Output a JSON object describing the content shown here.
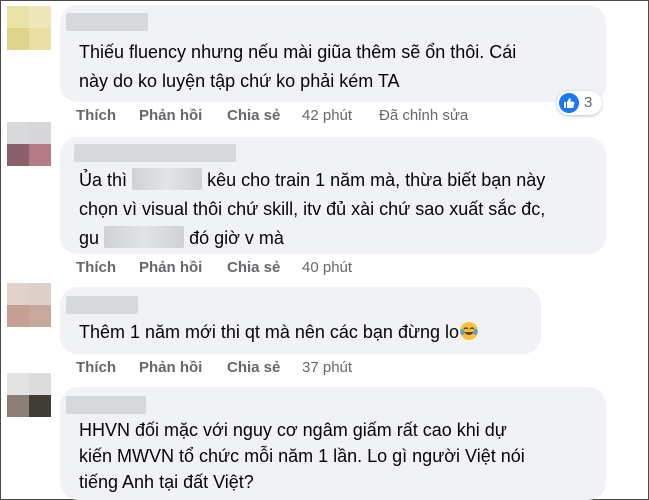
{
  "comments": [
    {
      "lines": [
        "Thiếu fluency nhưng nếu mài giũa thêm sẽ ổn thôi. Cái",
        "này do ko luyện tập chứ ko phải kém TA"
      ],
      "like": "Thích",
      "reply": "Phản hồi",
      "share": "Chia sẻ",
      "time": "42 phút",
      "edited": "Đã chỉnh sửa",
      "reaction_count": "3"
    },
    {
      "line1_a": "Ủa thì",
      "line1_b": "kêu cho train 1 năm mà, thừa biết bạn này",
      "line2": "chọn vì visual thôi chứ skill, itv đủ xài chứ sao xuất sắc đc,",
      "line3_a": "gu",
      "line3_b": "đó giờ v mà",
      "like": "Thích",
      "reply": "Phản hồi",
      "share": "Chia sẻ",
      "time": "40 phút"
    },
    {
      "line1": "Thêm 1 năm mới thi qt mà nên các bạn đừng lo",
      "emoji": "tears-of-joy-emoji",
      "like": "Thích",
      "reply": "Phản hồi",
      "share": "Chia sẻ",
      "time": "37 phút"
    },
    {
      "lines": [
        "HHVN đối mặc với nguy cơ ngâm giấm rất cao khi dự",
        "kiến MWVN tổ chức mỗi năm 1 lần. Lo gì người Việt nói",
        "tiếng Anh tại đất Việt?"
      ]
    }
  ],
  "colors": {
    "bubble": "#f0f2f5",
    "accent": "#1877f2",
    "meta": "#65676b"
  }
}
